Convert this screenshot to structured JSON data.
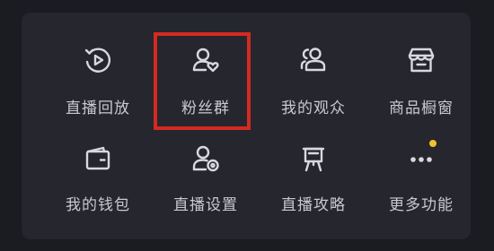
{
  "menu": {
    "items": [
      {
        "label": "直播回放",
        "icon": "replay-play-icon"
      },
      {
        "label": "粉丝群",
        "icon": "fan-group-heart-icon"
      },
      {
        "label": "我的观众",
        "icon": "audience-users-icon"
      },
      {
        "label": "商品橱窗",
        "icon": "shop-window-icon"
      },
      {
        "label": "我的钱包",
        "icon": "wallet-icon"
      },
      {
        "label": "直播设置",
        "icon": "user-settings-icon"
      },
      {
        "label": "直播攻略",
        "icon": "easel-guide-icon"
      },
      {
        "label": "更多功能",
        "icon": "more-dots-icon"
      }
    ],
    "highlighted_item": "粉丝群",
    "badge_on": "更多功能"
  },
  "colors": {
    "background": "#1b1c22",
    "panel": "#25262e",
    "text": "#c9c9d0",
    "icon_stroke": "#d8d8de",
    "highlight_border": "#d42a22",
    "badge": "#f2c12e"
  }
}
